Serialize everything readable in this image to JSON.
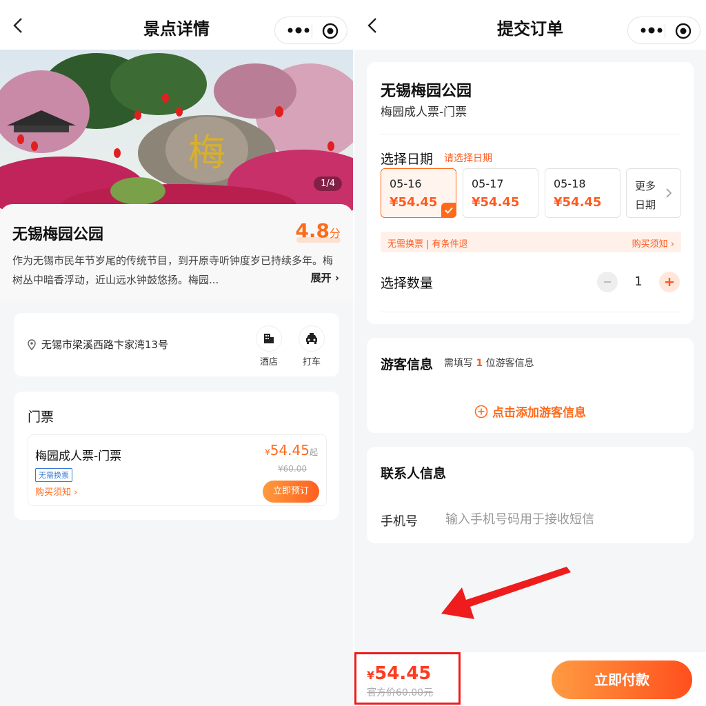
{
  "left_screen": {
    "nav_title": "景点详情",
    "hero": {
      "counter": "1/4"
    },
    "spot": {
      "name": "无锡梅园公园",
      "score": "4.8",
      "score_unit": "分",
      "description": "作为无锡市民年节岁尾的传统节目，到开原寺听钟度岁已持续多年。梅树丛中暗香浮动，近山远水钟鼓悠扬。梅园...",
      "expand_label": "展开 ›"
    },
    "address": {
      "text": "无锡市梁溪西路卞家湾13号",
      "hotel_label": "酒店",
      "taxi_label": "打车"
    },
    "tickets": {
      "section_title": "门票",
      "item": {
        "name": "梅园成人票-门票",
        "tag": "无需换票",
        "notice": "购买须知 ›",
        "currency": "¥",
        "price": "54.45",
        "price_suffix": "起",
        "original_price": "¥60.00",
        "book_label": "立即预订"
      }
    }
  },
  "right_screen": {
    "nav_title": "提交订单",
    "order": {
      "name": "无锡梅园公园",
      "ticket": "梅园成人票-门票",
      "select_date_label": "选择日期",
      "select_date_hint": "请选择日期",
      "dates": [
        {
          "date": "05-16",
          "price": "¥54.45",
          "selected": true
        },
        {
          "date": "05-17",
          "price": "¥54.45",
          "selected": false
        },
        {
          "date": "05-18",
          "price": "¥54.45",
          "selected": false
        }
      ],
      "more_dates": "更多\n日期",
      "notice_left": "无需换票 | 有条件退",
      "notice_right": "购买须知 ›",
      "quantity_label": "选择数量",
      "quantity": "1"
    },
    "visitor": {
      "title": "游客信息",
      "hint_prefix": "需填写",
      "hint_count": "1",
      "hint_suffix": "位游客信息",
      "add_label": "点击添加游客信息"
    },
    "contact": {
      "title": "联系人信息",
      "phone_label": "手机号",
      "phone_placeholder": "输入手机号码用于接收短信"
    },
    "footer": {
      "currency": "¥",
      "total": "54.45",
      "official_price": "官方价60.00元",
      "pay_label": "立即付款"
    }
  },
  "colors": {
    "accent": "#ff6a1a",
    "price": "#ff3b1f",
    "highlight_box": "#ee1c1c",
    "tag_blue": "#3a78d6"
  }
}
